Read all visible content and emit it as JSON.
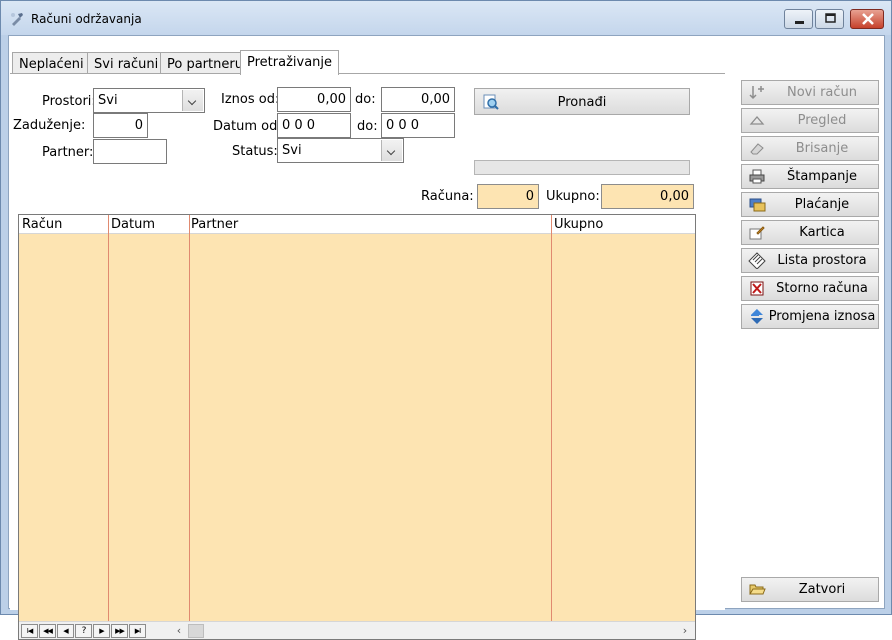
{
  "window": {
    "title": "Računi održavanja"
  },
  "tabs": [
    {
      "label": "Neplaćeni"
    },
    {
      "label": "Svi računi"
    },
    {
      "label": "Po partneru"
    },
    {
      "label": "Pretraživanje"
    }
  ],
  "search": {
    "prostori_label": "Prostori:",
    "prostori_value": "Svi",
    "zaduzenje_label": "Zaduženje:",
    "zaduzenje_value": "0",
    "partner_label": "Partner:",
    "partner_value": "",
    "iznos_od_label": "Iznos od:",
    "iznos_od_value": "0,00",
    "iznos_do_label": "do:",
    "iznos_do_value": "0,00",
    "datum_od_label": "Datum od:",
    "datum_od_value": "0 0  0",
    "datum_do_label": "do:",
    "datum_do_value": "0 0  0",
    "status_label": "Status:",
    "status_value": "Svi",
    "find_button": "Pronađi",
    "progress": 0,
    "racuna_label": "Računa:",
    "racuna_value": "0",
    "ukupno_label": "Ukupno:",
    "ukupno_value": "0,00"
  },
  "grid": {
    "columns": [
      "Račun",
      "Datum",
      "Partner",
      "Ukupno"
    ],
    "rows": [],
    "nav": {
      "first": "I◀",
      "prev_page": "◀◀",
      "prev": "◀",
      "find": "?",
      "next": "▶",
      "next_page": "▶▶",
      "last": "▶I"
    }
  },
  "side_buttons": [
    {
      "label": "Novi račun",
      "icon": "new-invoice-icon",
      "enabled": false
    },
    {
      "label": "Pregled",
      "icon": "preview-icon",
      "enabled": false
    },
    {
      "label": "Brisanje",
      "icon": "eraser-icon",
      "enabled": false
    },
    {
      "label": "Štampanje",
      "icon": "printer-icon",
      "enabled": true
    },
    {
      "label": "Plaćanje",
      "icon": "payment-icon",
      "enabled": true
    },
    {
      "label": "Kartica",
      "icon": "card-icon",
      "enabled": true
    },
    {
      "label": "Lista prostora",
      "icon": "list-icon",
      "enabled": true
    },
    {
      "label": "Storno računa",
      "icon": "cancel-invoice-icon",
      "enabled": true
    },
    {
      "label": "Promjena iznosa",
      "icon": "change-amount-icon",
      "enabled": true
    }
  ],
  "close_button": {
    "label": "Zatvori",
    "icon": "folder-open-icon"
  },
  "colors": {
    "grid_background": "#fde4b2",
    "column_line": "#e08a70",
    "window_frame": "#bcd0e8"
  }
}
